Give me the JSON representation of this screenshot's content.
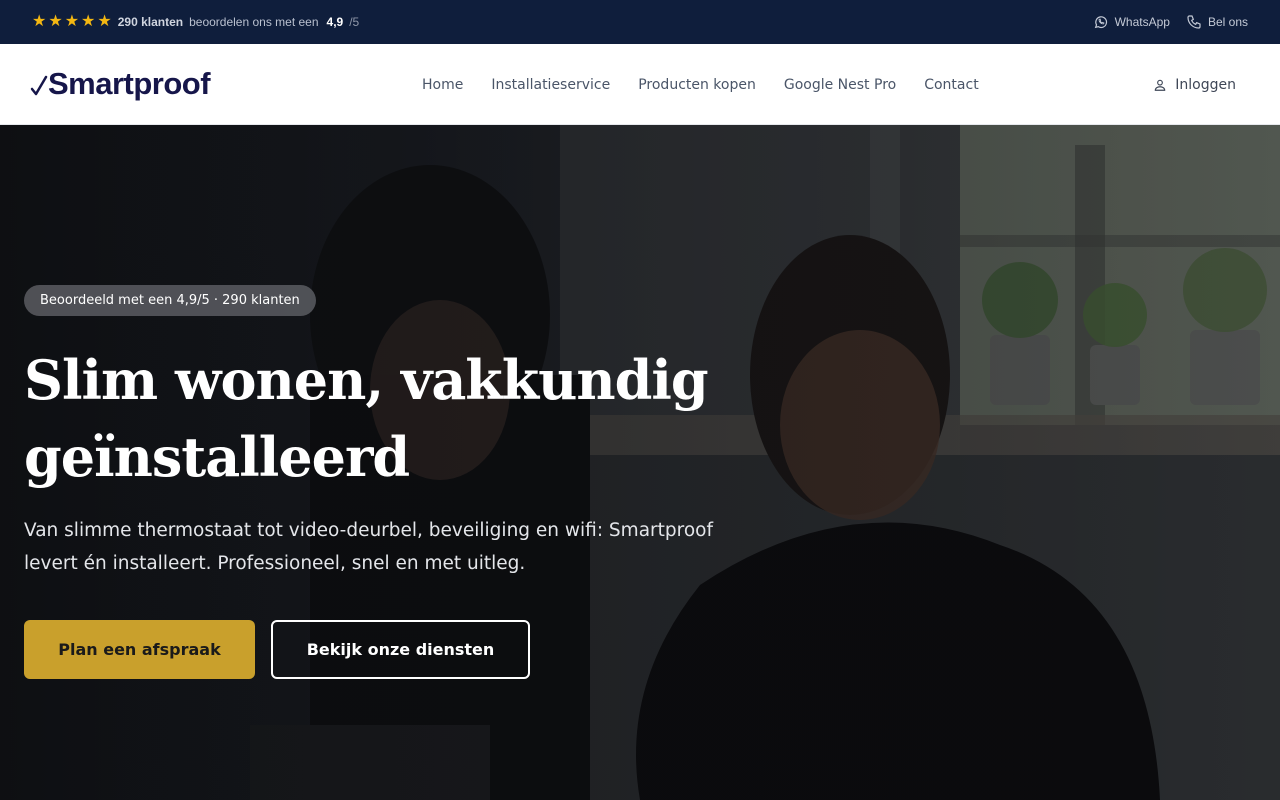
{
  "topbar": {
    "rating_count": "290 klanten",
    "rating_text": "beoordelen ons met een",
    "rating_score": "4,9",
    "rating_outof": "/5",
    "whatsapp_label": "WhatsApp",
    "call_label": "Bel ons"
  },
  "header": {
    "logo_text": "Smartproof",
    "nav": [
      "Home",
      "Installatieservice",
      "Producten kopen",
      "Google Nest Pro",
      "Contact"
    ],
    "login_label": "Inloggen"
  },
  "hero": {
    "badge": "Beoordeeld met een 4,9/5 · 290 klanten",
    "title_line1": "Slim wonen, vakkundig",
    "title_line2": "geïnstalleerd",
    "subtitle": "Van slimme thermostaat tot video-deurbel, beveiliging en wifi: Smartproof levert én installeert. Professioneel, snel en met uitleg.",
    "cta_primary": "Plan een afspraak",
    "cta_secondary": "Bekijk onze diensten"
  },
  "colors": {
    "topbar_bg": "#0f1e3c",
    "star": "#f3b712",
    "brand": "#16164a",
    "accent_button": "#c9a02c"
  }
}
